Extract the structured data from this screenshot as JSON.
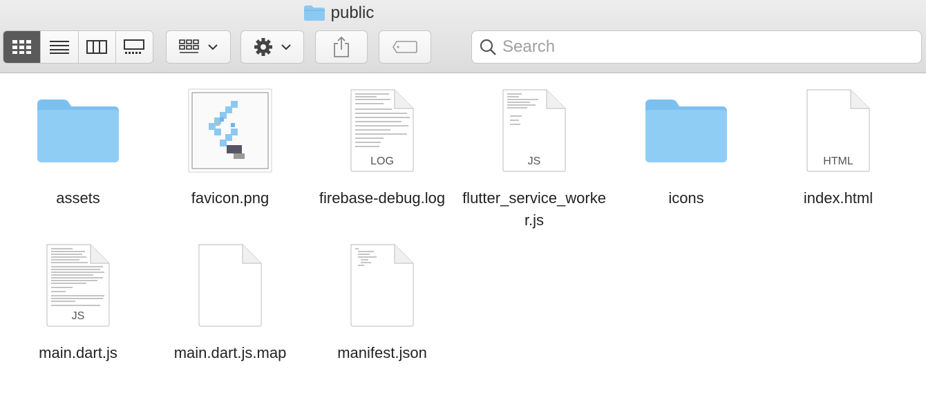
{
  "window": {
    "title": "public"
  },
  "toolbar": {
    "view_modes": [
      {
        "name": "icon-view",
        "active": true
      },
      {
        "name": "list-view",
        "active": false
      },
      {
        "name": "column-view",
        "active": false
      },
      {
        "name": "gallery-view",
        "active": false
      }
    ],
    "group_button": "group-icon",
    "action_button": "gear-icon",
    "share_button": "share-icon",
    "tags_button": "tag-icon"
  },
  "search": {
    "placeholder": "Search",
    "value": ""
  },
  "colors": {
    "folder": "#8cc9f1",
    "folder_dark": "#6fb6e8",
    "active_segment": "#5a5a5a"
  },
  "files": [
    {
      "name": "assets",
      "kind": "folder"
    },
    {
      "name": "favicon.png",
      "kind": "image"
    },
    {
      "name": "firebase-debug.log",
      "kind": "doc",
      "badge": "LOG"
    },
    {
      "name": "flutter_service_worker.js",
      "kind": "doc",
      "badge": "JS"
    },
    {
      "name": "icons",
      "kind": "folder"
    },
    {
      "name": "index.html",
      "kind": "doc",
      "badge": "HTML"
    },
    {
      "name": "main.dart.js",
      "kind": "doc",
      "badge": "JS"
    },
    {
      "name": "main.dart.js.map",
      "kind": "blank"
    },
    {
      "name": "manifest.json",
      "kind": "doc",
      "badge": ""
    }
  ]
}
